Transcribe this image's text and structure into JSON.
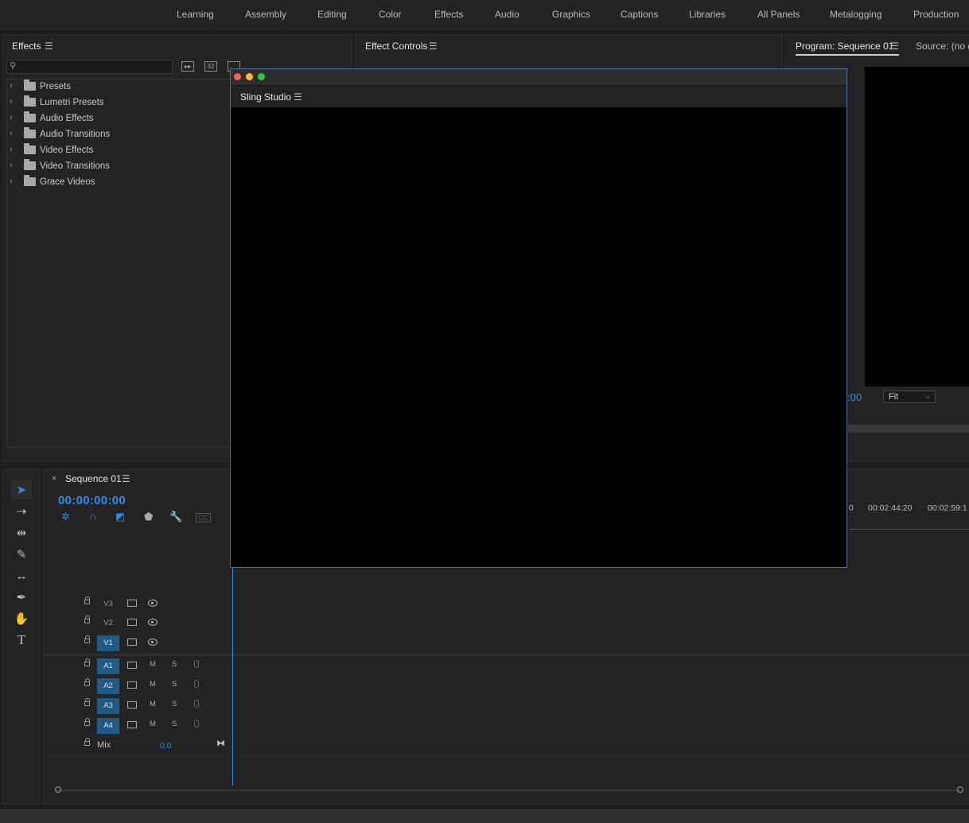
{
  "workspaces": [
    "Learning",
    "Assembly",
    "Editing",
    "Color",
    "Effects",
    "Audio",
    "Graphics",
    "Captions",
    "Libraries",
    "All Panels",
    "Metalogging",
    "Production"
  ],
  "effects_panel": {
    "title": "Effects",
    "search_placeholder": "",
    "filter_icons": [
      "accelerated-effects-icon",
      "32-bit-icon",
      "yuv-icon"
    ],
    "tree": [
      {
        "label": "Presets",
        "icon": "preset-folder-icon"
      },
      {
        "label": "Lumetri Presets",
        "icon": "preset-folder-icon"
      },
      {
        "label": "Audio Effects",
        "icon": "folder-icon"
      },
      {
        "label": "Audio Transitions",
        "icon": "folder-icon"
      },
      {
        "label": "Video Effects",
        "icon": "folder-icon"
      },
      {
        "label": "Video Transitions",
        "icon": "folder-icon"
      },
      {
        "label": "Grace Videos",
        "icon": "folder-icon"
      }
    ],
    "badge_32": "32"
  },
  "effect_controls": {
    "title": "Effect Controls"
  },
  "program_monitor": {
    "title": "Program: Sequence 01",
    "source_tab": "Source: (no cl",
    "timecode_fragment": ":00",
    "zoom": "Fit"
  },
  "floating_window": {
    "panel_title": "Sling Studio",
    "traffic_lights": [
      "#fe5f57",
      "#febc2e",
      "#28c840"
    ]
  },
  "timeline": {
    "sequence_name": "Sequence 01",
    "timecode": "00:00:00:00",
    "ruler_labels": [
      "0",
      "00:02:44:20",
      "00:02:59:1"
    ],
    "video_tracks": [
      {
        "label": "V3",
        "targeted": false
      },
      {
        "label": "V2",
        "targeted": false
      },
      {
        "label": "V1",
        "targeted": true
      }
    ],
    "audio_tracks": [
      {
        "label": "A1",
        "targeted": true
      },
      {
        "label": "A2",
        "targeted": true
      },
      {
        "label": "A3",
        "targeted": true
      },
      {
        "label": "A4",
        "targeted": true
      }
    ],
    "mute_label": "M",
    "solo_label": "S",
    "mix": {
      "label": "Mix",
      "value": "0.0"
    }
  },
  "tools": [
    "selection-tool",
    "track-select-tool",
    "ripple-edit-tool",
    "razor-tool",
    "slip-tool",
    "pen-tool",
    "hand-tool",
    "type-tool"
  ],
  "colors": {
    "accent": "#2d8ceb",
    "target": "#1f5a86",
    "panel": "#232323",
    "background": "#1d1d1d"
  }
}
